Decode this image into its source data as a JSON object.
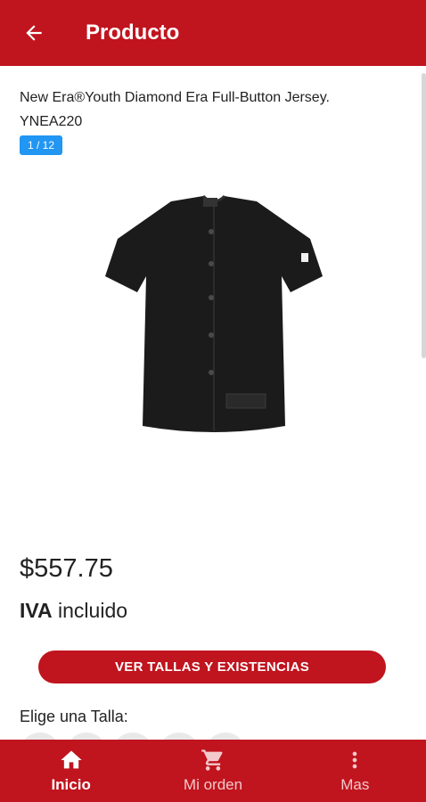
{
  "appbar": {
    "title": "Producto",
    "back_icon": "arrow-left-icon"
  },
  "product": {
    "title": "New Era®Youth Diamond Era Full-Button Jersey. YNEA220",
    "image_counter": "1 / 12",
    "image_desc_icon": "black-jersey-image",
    "price": "$557.75",
    "tax_bold": "IVA",
    "tax_rest": "incluido"
  },
  "actions": {
    "sizes_button": "VER TALLAS Y EXISTENCIAS"
  },
  "sizes": {
    "label": "Elige una Talla:"
  },
  "bottom_nav": {
    "items": [
      {
        "label": "Inicio",
        "icon": "home-icon",
        "active": true
      },
      {
        "label": "Mi orden",
        "icon": "cart-icon",
        "active": false
      },
      {
        "label": "Mas",
        "icon": "more-vertical-icon",
        "active": false
      }
    ]
  },
  "colors": {
    "primary": "#c0141e",
    "badge": "#2196f3",
    "text": "#222222"
  }
}
